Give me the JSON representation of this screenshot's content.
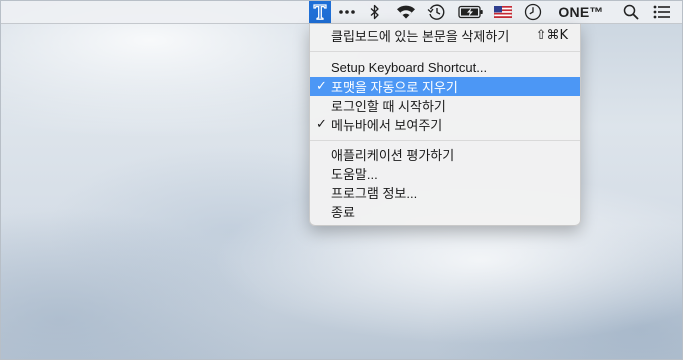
{
  "menubar": {
    "app_icon": "t-icon",
    "icons": [
      "more-dots-icon",
      "bluetooth-icon",
      "wifi-icon",
      "time-machine-icon",
      "battery-charging-icon",
      "us-flag-icon",
      "clock-icon",
      "search-icon",
      "list-icon"
    ],
    "app_name": "ONE™"
  },
  "menu": {
    "items": [
      {
        "label": "클립보드에 있는 본문을 삭제하기",
        "shortcut": "⇧⌘K",
        "checked": false
      },
      {
        "label": "Setup Keyboard Shortcut...",
        "shortcut": "",
        "checked": false
      },
      {
        "label": "포맷을 자동으로 지우기",
        "shortcut": "",
        "checked": true,
        "highlighted": true
      },
      {
        "label": "로그인할 때 시작하기",
        "shortcut": "",
        "checked": false
      },
      {
        "label": "메뉴바에서 보여주기",
        "shortcut": "",
        "checked": true
      },
      {
        "label": "애플리케이션 평가하기",
        "shortcut": "",
        "checked": false
      },
      {
        "label": "도움말...",
        "shortcut": "",
        "checked": false
      },
      {
        "label": "프로그램 정보...",
        "shortcut": "",
        "checked": false
      },
      {
        "label": "종료",
        "shortcut": "",
        "checked": false
      }
    ],
    "check_mark": "✓"
  },
  "colors": {
    "highlight": "#4c97f5",
    "app_icon_bg": "#1f6fd6"
  }
}
